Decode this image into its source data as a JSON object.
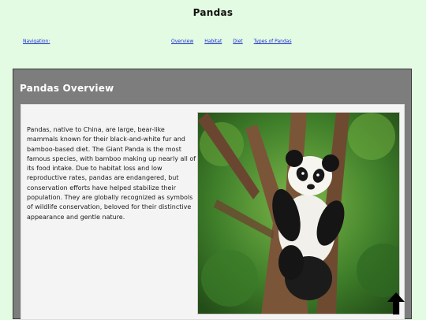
{
  "header": {
    "title": "Pandas"
  },
  "nav": {
    "label": "Navigation:",
    "links": [
      "Overview",
      "Habitat",
      "Diet",
      "Types of Pandas"
    ]
  },
  "overview": {
    "heading": "Pandas Overview",
    "paragraph": "Pandas, native to China, are large, bear-like mammals known for their black-and-white fur and bamboo-based diet. The Giant Panda is the most famous species, with bamboo making up nearly all of its food intake. Due to habitat loss and low reproductive rates, pandas are endangered, but conservation efforts have helped stabilize their population. They are globally recognized as symbols of wildlife conservation, beloved for their distinctive appearance and gentle nature.",
    "image_subject": "giant panda cub climbing a tree"
  },
  "icons": {
    "scroll_top": "arrow-up-icon"
  },
  "colors": {
    "page_bg": "#e2fbe2",
    "section_bg": "#7d7d7d",
    "content_bg": "#f4f4f4",
    "link": "#1d2fd0"
  }
}
